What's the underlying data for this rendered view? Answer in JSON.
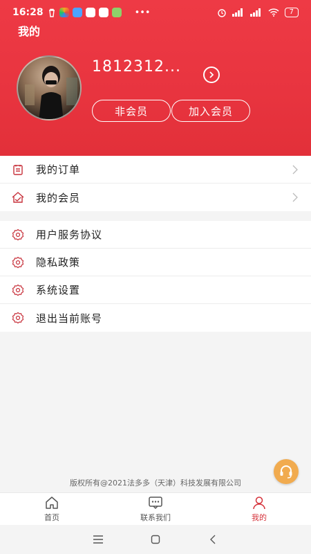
{
  "status_bar": {
    "time": "16:28",
    "battery": "7"
  },
  "header": {
    "title": "我的",
    "username": "1812312...",
    "member_status": "非会员",
    "join_member": "加入会员"
  },
  "menu": {
    "group1": [
      {
        "label": "我的订单",
        "icon": "order-icon"
      },
      {
        "label": "我的会员",
        "icon": "member-icon"
      }
    ],
    "group2": [
      {
        "label": "用户服务协议",
        "icon": "gear-icon"
      },
      {
        "label": "隐私政策",
        "icon": "gear-icon"
      },
      {
        "label": "系统设置",
        "icon": "gear-icon"
      },
      {
        "label": "退出当前账号",
        "icon": "gear-icon"
      }
    ]
  },
  "footer": {
    "copyright": "版权所有@2021法多多（天津）科技发展有限公司"
  },
  "tabbar": [
    {
      "label": "首页",
      "icon": "home-icon"
    },
    {
      "label": "联系我们",
      "icon": "chat-icon"
    },
    {
      "label": "我的",
      "icon": "user-icon",
      "active": true
    }
  ],
  "colors": {
    "brand": "#e8343f",
    "active": "#d5323a",
    "fab": "#f1ab4f"
  }
}
